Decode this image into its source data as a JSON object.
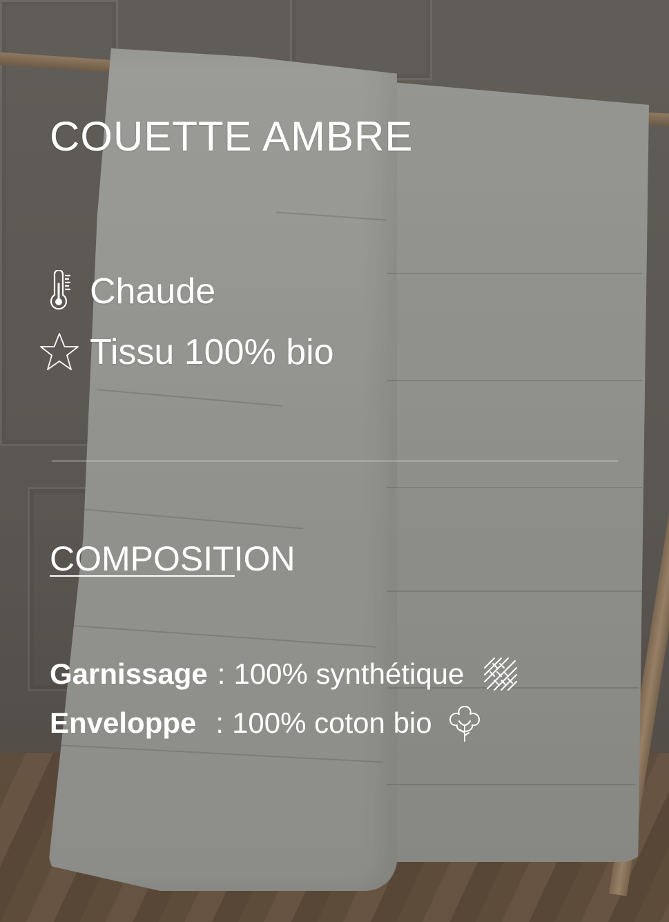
{
  "product": {
    "title": "COUETTE AMBRE"
  },
  "features": [
    {
      "icon": "thermometer-icon",
      "label": "Chaude"
    },
    {
      "icon": "star-icon",
      "label": "Tissu 100% bio"
    }
  ],
  "composition": {
    "heading": "COMPOSITION",
    "rows": [
      {
        "key": "Garnissage",
        "separator": ":",
        "value": "100% synthétique",
        "icon": "woven-fiber-icon"
      },
      {
        "key": "Enveloppe",
        "separator": ":",
        "value": "100% coton bio",
        "icon": "cotton-flower-icon"
      }
    ]
  },
  "colors": {
    "text": "#ffffff",
    "divider": "#e6e6e6",
    "overlay": "#282828"
  }
}
